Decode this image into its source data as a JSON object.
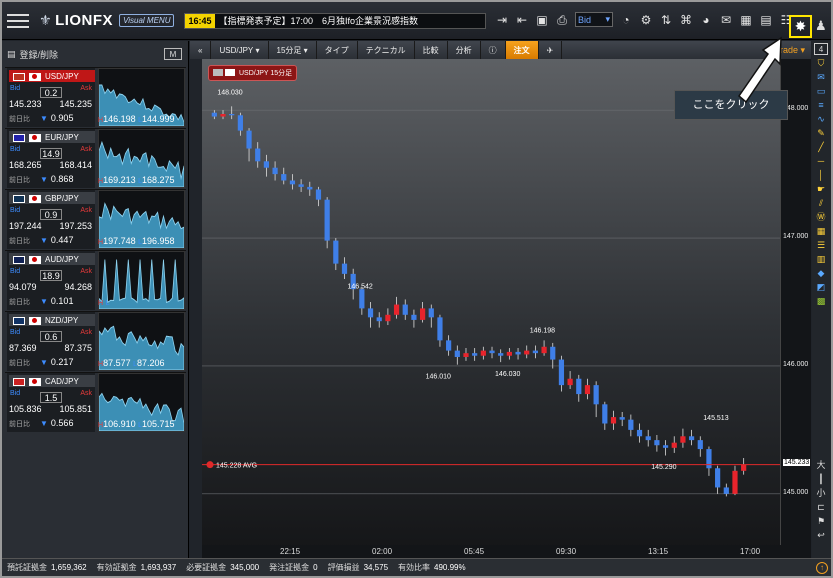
{
  "header": {
    "logo_text": "LIONFX",
    "visual_menu_label": "Visual MENU",
    "ticker_time": "16:45",
    "ticker_message": "【指標発表予定】17:00　6月独Ifo企業景況感指数",
    "price_type": "Bid"
  },
  "left_panel": {
    "register_label": "登録/削除",
    "mode_label": "M",
    "pairs": [
      {
        "symbol": "USD/JPY",
        "bid": "145.233",
        "ask": "145.235",
        "spread": "0.2",
        "change": "0.905",
        "high": "146.198",
        "low": "144.999",
        "active": true
      },
      {
        "symbol": "EUR/JPY",
        "bid": "168.265",
        "ask": "168.414",
        "spread": "14.9",
        "change": "0.868",
        "high": "169.213",
        "low": "168.275",
        "active": false
      },
      {
        "symbol": "GBP/JPY",
        "bid": "197.244",
        "ask": "197.253",
        "spread": "0.9",
        "change": "0.447",
        "high": "197.748",
        "low": "196.958",
        "active": false
      },
      {
        "symbol": "AUD/JPY",
        "bid": "94.079",
        "ask": "94.268",
        "spread": "18.9",
        "change": "0.101",
        "high": "",
        "low": "",
        "active": false
      },
      {
        "symbol": "NZD/JPY",
        "bid": "87.369",
        "ask": "87.375",
        "spread": "0.6",
        "change": "0.217",
        "high": "87.577",
        "low": "87.206",
        "active": false
      },
      {
        "symbol": "CAD/JPY",
        "bid": "105.836",
        "ask": "105.851",
        "spread": "1.5",
        "change": "0.566",
        "high": "106.910",
        "low": "105.715",
        "active": false
      }
    ],
    "bid_label": "Bid",
    "ask_label": "Ask",
    "change_label": "前日比",
    "high_prefix": "H",
    "low_prefix": "L"
  },
  "chart_toolbar": {
    "symbol": "USD/JPY",
    "timeframe": "15分足",
    "type_label": "タイプ",
    "technical_label": "テクニカル",
    "compare_label": "比較",
    "analysis_label": "分析",
    "order_label": "注文",
    "trade_label": "Trade"
  },
  "chart_tag": "USD/JPY 15分足",
  "callout_text": "ここをクリック",
  "avg_label": "145.228 AVG",
  "current_price": "145.233",
  "annotations": [
    "148.030",
    "146.542",
    "146.198",
    "146.010",
    "146.030",
    "145.513",
    "145.290"
  ],
  "chart_data": {
    "type": "candlestick",
    "ylim": [
      144.6,
      148.4
    ],
    "y_ticks": [
      "148.000",
      "147.000",
      "146.000",
      "145.000"
    ],
    "x_ticks": [
      "22:15",
      "02:00",
      "05:45",
      "09:30",
      "13:15",
      "17:00"
    ],
    "current": 145.233,
    "avg": 145.228,
    "candles": [
      [
        147.98,
        147.95,
        148.0,
        147.93
      ],
      [
        147.95,
        147.97,
        148.0,
        147.93
      ],
      [
        147.97,
        147.96,
        148.03,
        147.93
      ],
      [
        147.96,
        147.84,
        147.98,
        147.8
      ],
      [
        147.84,
        147.7,
        147.86,
        147.6
      ],
      [
        147.7,
        147.6,
        147.75,
        147.55
      ],
      [
        147.6,
        147.55,
        147.65,
        147.48
      ],
      [
        147.55,
        147.5,
        147.6,
        147.45
      ],
      [
        147.5,
        147.45,
        147.55,
        147.42
      ],
      [
        147.45,
        147.42,
        147.5,
        147.38
      ],
      [
        147.42,
        147.4,
        147.46,
        147.36
      ],
      [
        147.4,
        147.38,
        147.44,
        147.33
      ],
      [
        147.38,
        147.3,
        147.4,
        147.25
      ],
      [
        147.3,
        146.98,
        147.32,
        146.92
      ],
      [
        146.98,
        146.8,
        147.0,
        146.75
      ],
      [
        146.8,
        146.72,
        146.85,
        146.68
      ],
      [
        146.72,
        146.6,
        146.76,
        146.52
      ],
      [
        146.6,
        146.45,
        146.62,
        146.4
      ],
      [
        146.45,
        146.38,
        146.5,
        146.3
      ],
      [
        146.38,
        146.35,
        146.42,
        146.3
      ],
      [
        146.35,
        146.4,
        146.45,
        146.32
      ],
      [
        146.4,
        146.48,
        146.54,
        146.37
      ],
      [
        146.48,
        146.4,
        146.52,
        146.36
      ],
      [
        146.4,
        146.36,
        146.44,
        146.3
      ],
      [
        146.36,
        146.45,
        146.5,
        146.34
      ],
      [
        146.45,
        146.38,
        146.48,
        146.3
      ],
      [
        146.38,
        146.2,
        146.4,
        146.15
      ],
      [
        146.2,
        146.12,
        146.24,
        146.08
      ],
      [
        146.12,
        146.07,
        146.16,
        146.01
      ],
      [
        146.07,
        146.1,
        146.14,
        146.04
      ],
      [
        146.1,
        146.08,
        146.14,
        146.04
      ],
      [
        146.08,
        146.12,
        146.15,
        146.05
      ],
      [
        146.12,
        146.1,
        146.15,
        146.06
      ],
      [
        146.1,
        146.08,
        146.13,
        146.03
      ],
      [
        146.08,
        146.11,
        146.14,
        146.05
      ],
      [
        146.11,
        146.09,
        146.14,
        146.05
      ],
      [
        146.09,
        146.12,
        146.16,
        146.06
      ],
      [
        146.12,
        146.1,
        146.16,
        146.06
      ],
      [
        146.1,
        146.15,
        146.2,
        146.08
      ],
      [
        146.15,
        146.05,
        146.18,
        145.98
      ],
      [
        146.05,
        145.85,
        146.08,
        145.8
      ],
      [
        145.85,
        145.9,
        145.96,
        145.82
      ],
      [
        145.9,
        145.78,
        145.93,
        145.72
      ],
      [
        145.78,
        145.85,
        145.9,
        145.74
      ],
      [
        145.85,
        145.7,
        145.88,
        145.6
      ],
      [
        145.7,
        145.55,
        145.72,
        145.5
      ],
      [
        145.55,
        145.6,
        145.65,
        145.5
      ],
      [
        145.6,
        145.58,
        145.64,
        145.53
      ],
      [
        145.58,
        145.5,
        145.62,
        145.45
      ],
      [
        145.5,
        145.45,
        145.55,
        145.4
      ],
      [
        145.45,
        145.42,
        145.5,
        145.37
      ],
      [
        145.42,
        145.38,
        145.46,
        145.33
      ],
      [
        145.38,
        145.36,
        145.42,
        145.3
      ],
      [
        145.36,
        145.4,
        145.45,
        145.32
      ],
      [
        145.4,
        145.45,
        145.51,
        145.36
      ],
      [
        145.45,
        145.42,
        145.5,
        145.38
      ],
      [
        145.42,
        145.35,
        145.45,
        145.29
      ],
      [
        145.35,
        145.2,
        145.37,
        145.14
      ],
      [
        145.2,
        145.05,
        145.22,
        145.0
      ],
      [
        145.05,
        145.0,
        145.08,
        144.98
      ],
      [
        145.0,
        145.18,
        145.22,
        144.99
      ],
      [
        145.18,
        145.23,
        145.28,
        145.15
      ]
    ]
  },
  "status_bar": {
    "items": [
      {
        "label": "預託証拠金",
        "value": "1,659,362"
      },
      {
        "label": "有効証拠金",
        "value": "1,693,937"
      },
      {
        "label": "必要証拠金",
        "value": "345,000"
      },
      {
        "label": "発注証拠金",
        "value": "0"
      },
      {
        "label": "評価損益",
        "value": "34,575"
      },
      {
        "label": "有効比率",
        "value": "490.99%"
      }
    ]
  },
  "right_toolbar": {
    "badge": "4"
  }
}
